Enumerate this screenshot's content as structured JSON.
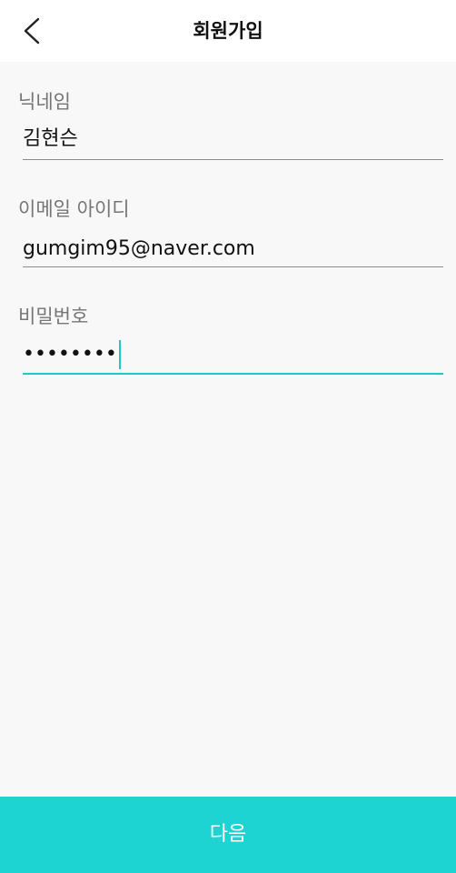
{
  "header": {
    "title": "회원가입",
    "back_icon": "chevron-left-icon"
  },
  "form": {
    "nickname": {
      "label": "닉네임",
      "value": "김현슨"
    },
    "email": {
      "label": "이메일 아이디",
      "value": "gumgim95@naver.com"
    },
    "password": {
      "label": "비밀번호",
      "masked_value": "••••••••"
    }
  },
  "footer": {
    "next_label": "다음"
  },
  "colors": {
    "accent": "#1ed4d2",
    "focus_underline": "#1cc8c8",
    "label": "#757575",
    "background": "#f8f8f8"
  }
}
